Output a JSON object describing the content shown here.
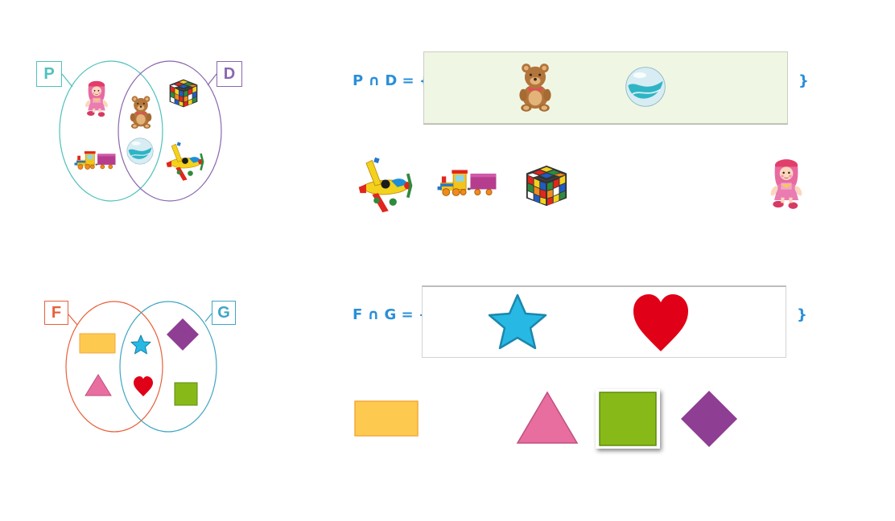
{
  "venn1": {
    "left_label": "P",
    "right_label": "D",
    "left_color": "#4fc1bd",
    "right_color": "#8b67ad",
    "left_only": [
      "doll-icon",
      "train-icon"
    ],
    "intersection": [
      "teddy-bear-icon",
      "marble-icon"
    ],
    "right_only": [
      "rubiks-cube-icon",
      "airplane-icon"
    ]
  },
  "venn2": {
    "left_label": "F",
    "right_label": "G",
    "left_color": "#e8603a",
    "right_color": "#3fa6c4",
    "left_only": [
      "yellow-rectangle",
      "pink-triangle"
    ],
    "intersection": [
      "blue-star",
      "red-heart"
    ],
    "right_only": [
      "purple-diamond",
      "green-square"
    ]
  },
  "equation1": {
    "left": "P ∩ D = {",
    "right": "}",
    "answer_items": [
      "teddy-bear-icon",
      "marble-icon"
    ],
    "answer_bg": "#eff7e4"
  },
  "choices1": [
    "airplane-icon",
    "train-icon",
    "rubiks-cube-icon",
    "doll-icon"
  ],
  "equation2": {
    "left": "F ∩ G = {",
    "right": "}",
    "answer_items": [
      "blue-star",
      "red-heart"
    ],
    "answer_bg": "#ffffff"
  },
  "choices2": [
    "yellow-rectangle",
    "pink-triangle",
    "green-square",
    "purple-diamond"
  ],
  "colors": {
    "equation_text": "#2a8fd8",
    "yellow": "#fec94f",
    "pink": "#e96ea0",
    "blue": "#27b9e3",
    "red": "#e00017",
    "green": "#87ba18",
    "purple": "#8e3e93"
  }
}
